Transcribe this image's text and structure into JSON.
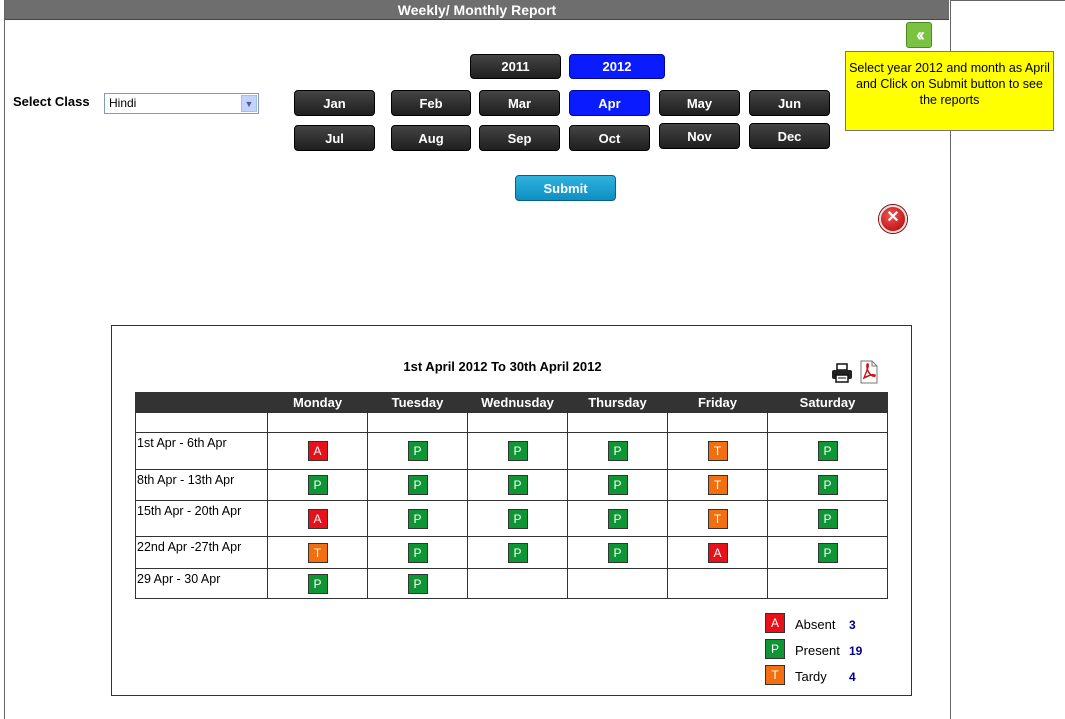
{
  "title": "Weekly/ Monthly  Report",
  "tooltip": "Select year 2012 and month as April and Click on Submit button to see the reports",
  "select_class": {
    "label": "Select Class",
    "value": "Hindi"
  },
  "years": [
    "2011",
    "2012"
  ],
  "selected_year": "2012",
  "months": [
    "Jan",
    "Feb",
    "Mar",
    "Apr",
    "May",
    "Jun",
    "Jul",
    "Aug",
    "Sep",
    "Oct",
    "Nov",
    "Dec"
  ],
  "selected_month": "Apr",
  "submit_label": "Submit",
  "report": {
    "title": "1st April 2012 To 30th April 2012",
    "columns": [
      "Monday",
      "Tuesday",
      "Wednusday",
      "Thursday",
      "Friday",
      "Saturday"
    ],
    "rows": [
      {
        "week": "1st Apr - 6th Apr",
        "marks": [
          "A",
          "P",
          "P",
          "P",
          "T",
          "P"
        ]
      },
      {
        "week": "8th Apr - 13th Apr",
        "marks": [
          "P",
          "P",
          "P",
          "P",
          "T",
          "P"
        ]
      },
      {
        "week": "15th Apr - 20th Apr",
        "marks": [
          "A",
          "P",
          "P",
          "P",
          "T",
          "P"
        ]
      },
      {
        "week": "22nd Apr -27th Apr",
        "marks": [
          "T",
          "P",
          "P",
          "P",
          "A",
          "P"
        ]
      },
      {
        "week": "29 Apr - 30 Apr",
        "marks": [
          "P",
          "P",
          "",
          "",
          "",
          ""
        ]
      }
    ]
  },
  "legend": [
    {
      "code": "A",
      "label": "Absent",
      "count": "3"
    },
    {
      "code": "P",
      "label": "Present",
      "count": "19"
    },
    {
      "code": "T",
      "label": "Tardy",
      "count": "4"
    }
  ],
  "colors": {
    "A": "#e8111a",
    "P": "#0f9634",
    "T": "#f26e0e",
    "active": "#0a1cff",
    "tooltip": "#ffff00"
  }
}
